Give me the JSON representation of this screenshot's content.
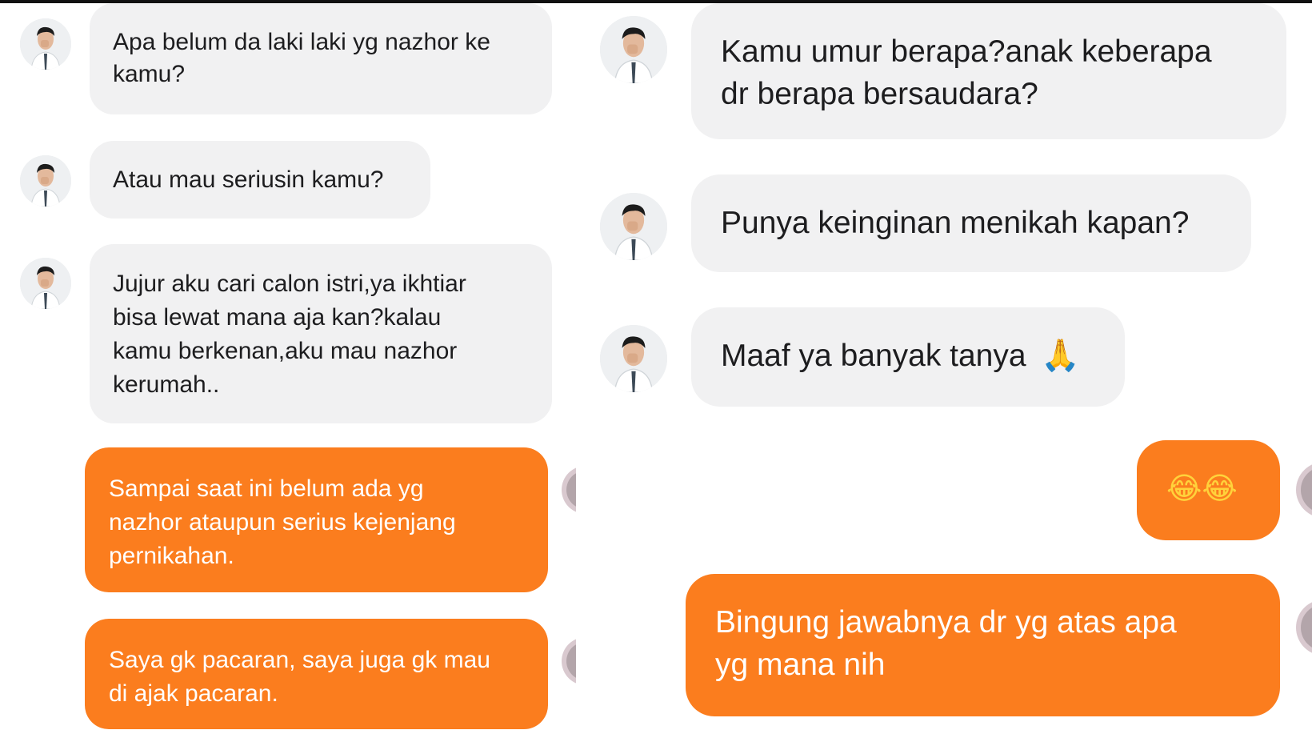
{
  "left_chat": {
    "incoming": [
      {
        "text": "Apa belum da laki laki yg nazhor ke\nkamu?"
      },
      {
        "text": "Atau mau seriusin kamu?"
      },
      {
        "text": "Jujur aku cari calon istri,ya ikhtiar\nbisa lewat mana aja kan?kalau\nkamu berkenan,aku mau nazhor\nkerumah.."
      }
    ],
    "outgoing": [
      {
        "text": "Sampai saat ini belum ada yg\nnazhor ataupun serius kejenjang\npernikahan."
      },
      {
        "text": "Saya gk pacaran, saya juga gk mau\ndi ajak pacaran."
      }
    ]
  },
  "right_chat": {
    "incoming": [
      {
        "text": "Kamu umur berapa?anak keberapa\ndr berapa bersaudara?"
      },
      {
        "text": "Punya keinginan menikah kapan?"
      },
      {
        "text": "Maaf ya banyak tanya",
        "emoji": "🙏"
      }
    ],
    "outgoing": [
      {
        "text": "😂😂"
      },
      {
        "text": "Bingung jawabnya dr yg atas apa\nyg mana nih"
      }
    ]
  },
  "colors": {
    "incoming_bubble": "#f1f1f2",
    "outgoing_bubble": "#fb7d1e",
    "incoming_text": "#1d1d1f",
    "outgoing_text": "#ffffff"
  },
  "icons": {
    "contact_avatar": "profile-photo-avatar",
    "own_avatar": "partial-avatar-at-edge",
    "emoji_pray": "folded-hands-emoji",
    "emoji_laugh": "tears-of-joy-emoji"
  }
}
